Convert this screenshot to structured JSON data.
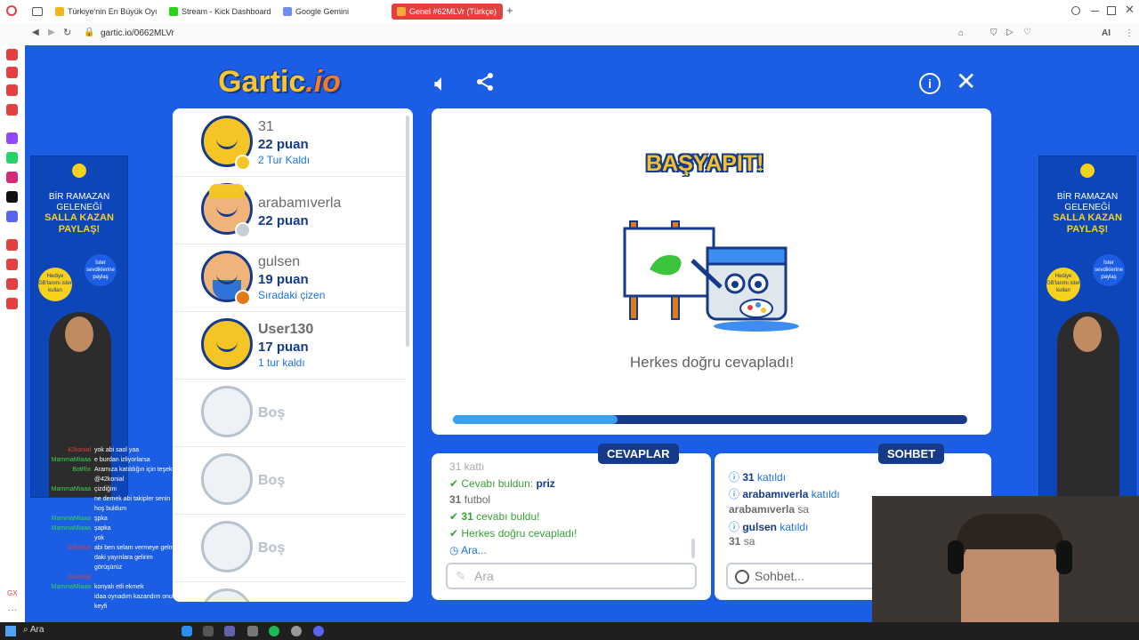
{
  "browser": {
    "tabs": [
      {
        "label": "Türkiye'nin En Büyük Oyun",
        "color": "#f2b41e"
      },
      {
        "label": "Stream - Kick Dashboard",
        "color": "#2ad21b"
      },
      {
        "label": "Google Gemini",
        "color": "#6f8cf0"
      },
      {
        "label": "Genel #62MLVr (Türkçe)",
        "color": "#f7a73c"
      }
    ],
    "url": "gartic.io/0662MLVr",
    "profile_initial": "F",
    "ai_label": "AI"
  },
  "game": {
    "logo_main": "Gartic",
    "logo_suffix": ".io",
    "players": [
      {
        "name": "31",
        "points": "22 puan",
        "status": "2 Tur Kaldı",
        "badge_color": "#f5c425"
      },
      {
        "name": "arabamıverla",
        "points": "22 puan",
        "status": "",
        "badge_color": "#c9ced4"
      },
      {
        "name": "gulsen",
        "points": "19 puan",
        "status": "Sıradaki çizen",
        "badge_color": "#e07b16"
      },
      {
        "name": "User130",
        "points": "17 puan",
        "status": "1 tur kaldı",
        "badge_color": ""
      }
    ],
    "empty_slot": "Boş",
    "stage_title": "BAŞYAPIT!",
    "stage_message": "Herkes doğru cevapladı!",
    "progress_fraction": 0.32,
    "answers_label": "CEVAPLAR",
    "chat_label": "SOHBET",
    "answers": {
      "partial_top": "31 kattı",
      "found_prefix": "Cevabı buldun: ",
      "found_word": "priz",
      "guess_user": "31",
      "guess_word": "futbol",
      "user_found": "31",
      "user_found_text": "cevabı buldu!",
      "all_correct": "Herkes doğru cevapladı!",
      "searching": "Ara...",
      "input_placeholder": "Ara"
    },
    "chat": {
      "join1_user": "31",
      "join1_text": "katıldı",
      "join2_user": "arabamıverla",
      "join2_text": "katıldı",
      "msg1_user": "arabamıverla",
      "msg1_text": "sa",
      "join3_user": "gulsen",
      "join3_text": "katıldı",
      "msg2_user": "31",
      "msg2_text": "sa",
      "input_placeholder": "Sohbet..."
    }
  },
  "ads": {
    "line1": "BİR RAMAZAN GELENEĞİ",
    "line2": "SALLA KAZAN PAYLAŞ!",
    "bubble_left": "Hediye GB'larımı ister kullan",
    "bubble_right": "İster sevdiklerine paylaş"
  },
  "stream_chat": [
    {
      "user": "42konial",
      "msg": "yok abi saol yaa",
      "color": "#e33b3b"
    },
    {
      "user": "MammaMiaaa",
      "msg": "e burdan izliyorlarsa",
      "color": "#39d353"
    },
    {
      "user": "BotRix",
      "msg": "Aramıza katıldığın için teşekkürler",
      "color": "#39d353"
    },
    {
      "user": "",
      "msg": "@42konial",
      "color": "#ffffff"
    },
    {
      "user": "MammaMiaaa",
      "msg": "çizdiğini",
      "color": "#39d353"
    },
    {
      "user": "",
      "msg": "ne demek abi takipler senin",
      "color": "#e33b3b"
    },
    {
      "user": "",
      "msg": "hoş buldum",
      "color": "#ffffff"
    },
    {
      "user": "MammaMiaaa",
      "msg": "şpka",
      "color": "#39d353"
    },
    {
      "user": "MammaMiaaa",
      "msg": "şapka",
      "color": "#39d353"
    },
    {
      "user": "",
      "msg": "yok",
      "color": "#e33b3b"
    },
    {
      "user": "42konial",
      "msg": "abi ben selam vermeye gelmiştim",
      "color": "#e33b3b"
    },
    {
      "user": "",
      "msg": "daki yayınlara gelirim",
      "color": "#ffffff"
    },
    {
      "user": "",
      "msg": "görüşürüz",
      "color": "#ffffff"
    },
    {
      "user": "42konial",
      "msg": "",
      "color": "#e33b3b"
    },
    {
      "user": "MammaMiaaa",
      "msg": "konyalı etli ekmek",
      "color": "#39d353"
    },
    {
      "user": "",
      "msg": "idaa oynadım kazandım onunlada",
      "color": "#e33b3b"
    },
    {
      "user": "",
      "msg": "keyfi",
      "color": "#ffffff"
    }
  ],
  "taskbar": {
    "search_placeholder": "Ara"
  }
}
